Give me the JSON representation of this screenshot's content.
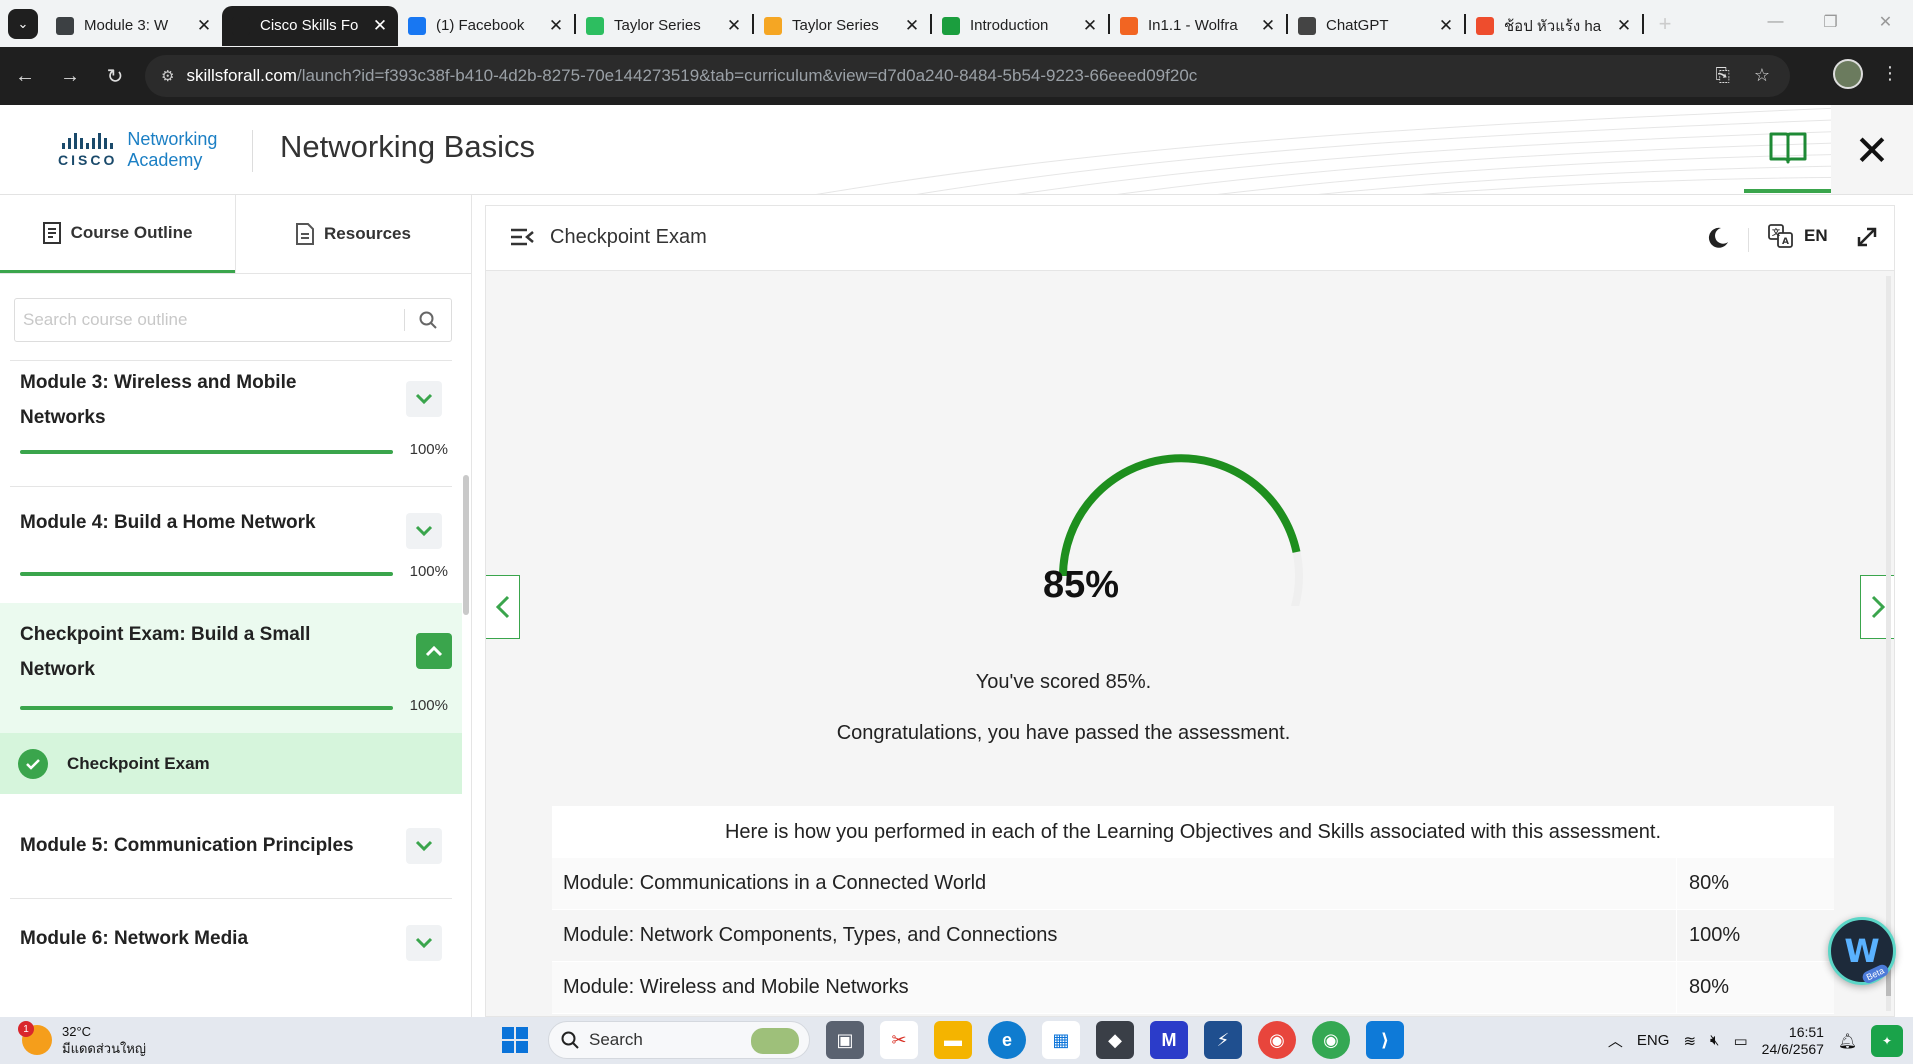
{
  "browser": {
    "tabs": [
      {
        "label": "Module 3: W",
        "favicon_color": "#3c4043",
        "active": false
      },
      {
        "label": "Cisco Skills Fo",
        "favicon_color": "#1f1f1f",
        "active": true
      },
      {
        "label": "(1) Facebook",
        "favicon_color": "#1877f2",
        "active": false
      },
      {
        "label": "Taylor Series",
        "favicon_color": "#2dbe60",
        "active": false
      },
      {
        "label": "Taylor Series",
        "favicon_color": "#f5a623",
        "active": false
      },
      {
        "label": "Introduction",
        "favicon_color": "#1b9e3e",
        "active": false
      },
      {
        "label": "In1.1 - Wolfra",
        "favicon_color": "#f26522",
        "active": false
      },
      {
        "label": "ChatGPT",
        "favicon_color": "#444444",
        "active": false
      },
      {
        "label": "ช้อป หัวแร้ง ha",
        "favicon_color": "#ee4d2d",
        "active": false
      }
    ],
    "url_host": "skillsforall.com",
    "url_path": "/launch?id=f393c38f-b410-4d2b-8275-70e144273519&tab=curriculum&view=d7d0a240-8484-5b54-9223-66eeed09f20c"
  },
  "header": {
    "logo_word": "CISCO",
    "logo_line1": "Networking",
    "logo_line2": "Academy",
    "course_title": "Networking Basics"
  },
  "sidebar": {
    "tabs": [
      {
        "label": "Course Outline",
        "active": true
      },
      {
        "label": "Resources",
        "active": false
      }
    ],
    "search_placeholder": "Search course outline",
    "modules": [
      {
        "title": "Module 3: Wireless and Mobile Networks",
        "progress": "100%"
      },
      {
        "title": "Module 4: Build a Home Network",
        "progress": "100%"
      },
      {
        "title": "Checkpoint Exam: Build a Small Network",
        "progress": "100%"
      },
      {
        "title": "Module 5: Communication Principles"
      },
      {
        "title": "Module 6: Network Media"
      }
    ],
    "active_subitem": "Checkpoint Exam"
  },
  "main": {
    "toolbar_title": "Checkpoint Exam",
    "language": "EN",
    "score": "85%",
    "score_fraction": 0.85,
    "message_scored": "You've scored 85%.",
    "message_passed": "Congratulations, you have passed the assessment.",
    "results_header": "Here is how you performed in each of the Learning Objectives and Skills associated with this assessment.",
    "results": [
      {
        "name": "Module: Communications in a Connected World",
        "value": "80%"
      },
      {
        "name": "Module: Network Components, Types, and Connections",
        "value": "100%"
      },
      {
        "name": "Module: Wireless and Mobile Networks",
        "value": "80%"
      }
    ],
    "colors": {
      "accent": "#3aa54c",
      "gauge": "#1e8f1e",
      "gauge_track": "#efefef"
    }
  },
  "assistant": {
    "badge": "Beta"
  },
  "taskbar": {
    "weather_temp": "32°C",
    "weather_desc": "มีแดดส่วนใหญ่",
    "weather_badge": "1",
    "search_label": "Search",
    "language": "ENG",
    "time": "16:51",
    "date": "24/6/2567"
  }
}
